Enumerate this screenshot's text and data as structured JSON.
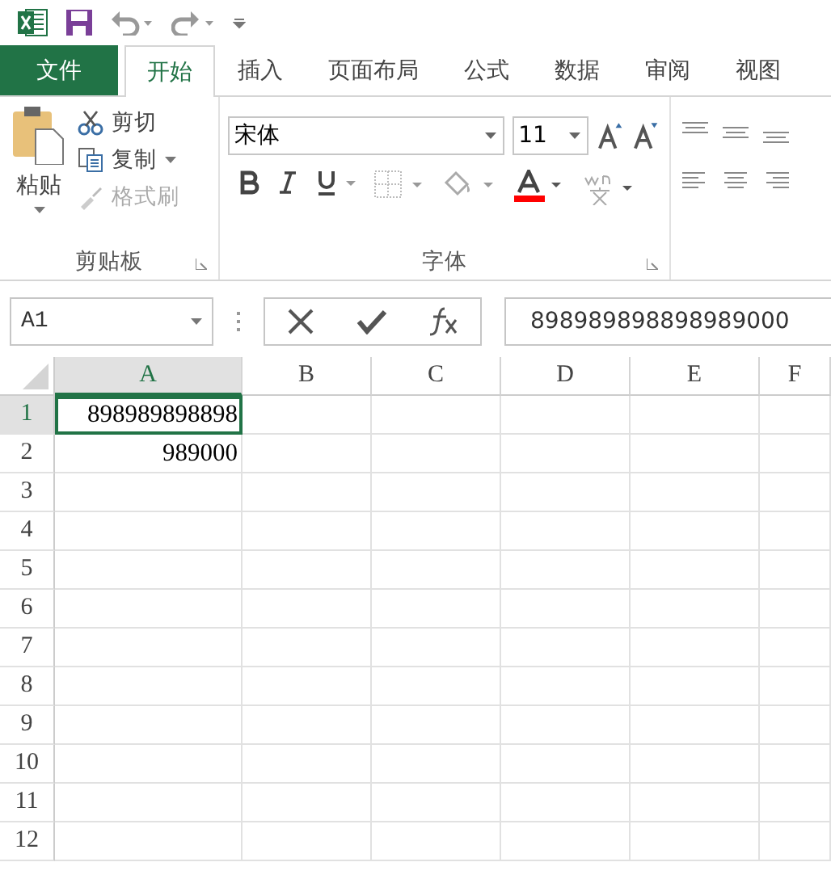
{
  "tabs": [
    {
      "label": "文件",
      "kind": "file",
      "selected": false
    },
    {
      "label": "开始",
      "kind": "tab",
      "selected": true
    },
    {
      "label": "插入",
      "kind": "tab",
      "selected": false
    },
    {
      "label": "页面布局",
      "kind": "tab",
      "selected": false
    },
    {
      "label": "公式",
      "kind": "tab",
      "selected": false
    },
    {
      "label": "数据",
      "kind": "tab",
      "selected": false
    },
    {
      "label": "审阅",
      "kind": "tab",
      "selected": false
    },
    {
      "label": "视图",
      "kind": "tab",
      "selected": false
    }
  ],
  "clipboard": {
    "paste": "粘贴",
    "actions": [
      {
        "label": "剪切",
        "kind": "cut",
        "disabled": false
      },
      {
        "label": "复制",
        "kind": "copy",
        "disabled": false
      },
      {
        "label": "格式刷",
        "kind": "painter",
        "disabled": true
      }
    ],
    "label": "剪贴板"
  },
  "font": {
    "name": "宋体",
    "size": "11",
    "label": "字体"
  },
  "name_box": "A1",
  "formula": "898989898898989000",
  "columns": [
    {
      "label": "A",
      "selected": true
    },
    {
      "label": "B",
      "selected": false
    },
    {
      "label": "C",
      "selected": false
    },
    {
      "label": "D",
      "selected": false
    },
    {
      "label": "E",
      "selected": false
    },
    {
      "label": "F",
      "selected": false
    }
  ],
  "rows": [
    {
      "header": "1",
      "selected": true,
      "cells": [
        "898989898898",
        "",
        "",
        "",
        "",
        ""
      ]
    },
    {
      "header": "2",
      "selected": false,
      "cells": [
        "989000",
        "",
        "",
        "",
        "",
        ""
      ]
    },
    {
      "header": "3",
      "selected": false,
      "cells": [
        "",
        "",
        "",
        "",
        "",
        ""
      ]
    },
    {
      "header": "4",
      "selected": false,
      "cells": [
        "",
        "",
        "",
        "",
        "",
        ""
      ]
    },
    {
      "header": "5",
      "selected": false,
      "cells": [
        "",
        "",
        "",
        "",
        "",
        ""
      ]
    },
    {
      "header": "6",
      "selected": false,
      "cells": [
        "",
        "",
        "",
        "",
        "",
        ""
      ]
    },
    {
      "header": "7",
      "selected": false,
      "cells": [
        "",
        "",
        "",
        "",
        "",
        ""
      ]
    },
    {
      "header": "8",
      "selected": false,
      "cells": [
        "",
        "",
        "",
        "",
        "",
        ""
      ]
    },
    {
      "header": "9",
      "selected": false,
      "cells": [
        "",
        "",
        "",
        "",
        "",
        ""
      ]
    },
    {
      "header": "10",
      "selected": false,
      "cells": [
        "",
        "",
        "",
        "",
        "",
        ""
      ]
    },
    {
      "header": "11",
      "selected": false,
      "cells": [
        "",
        "",
        "",
        "",
        "",
        ""
      ]
    },
    {
      "header": "12",
      "selected": false,
      "cells": [
        "",
        "",
        "",
        "",
        "",
        ""
      ]
    }
  ]
}
